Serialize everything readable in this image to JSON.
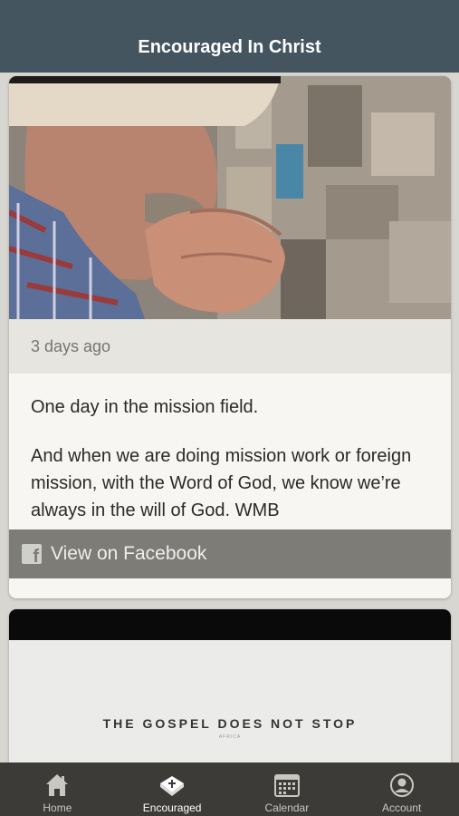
{
  "header": {
    "title": "Encouraged In Christ"
  },
  "feed": {
    "posts": [
      {
        "timestamp": "3 days ago",
        "paragraphs": [
          "One day in the mission field.",
          "And when we are doing mission work or foreign mission, with the Word of God, we know we’re always in the will of God. WMB"
        ],
        "link_label": "View on Facebook",
        "link_icon": "facebook-icon"
      },
      {
        "media_title": "THE GOSPEL DOES NOT STOP",
        "media_subtitle": "AFRICA"
      }
    ]
  },
  "tabbar": {
    "tabs": [
      {
        "label": "Home",
        "icon": "home-icon",
        "active": false
      },
      {
        "label": "Encouraged",
        "icon": "bible-icon",
        "active": true
      },
      {
        "label": "Calendar",
        "icon": "calendar-icon",
        "active": false
      },
      {
        "label": "Account",
        "icon": "account-icon",
        "active": false
      }
    ]
  },
  "colors": {
    "header_bg": "#445560",
    "tabbar_bg": "#3c3b37",
    "facebook_bar_bg": "#7d7c77"
  }
}
